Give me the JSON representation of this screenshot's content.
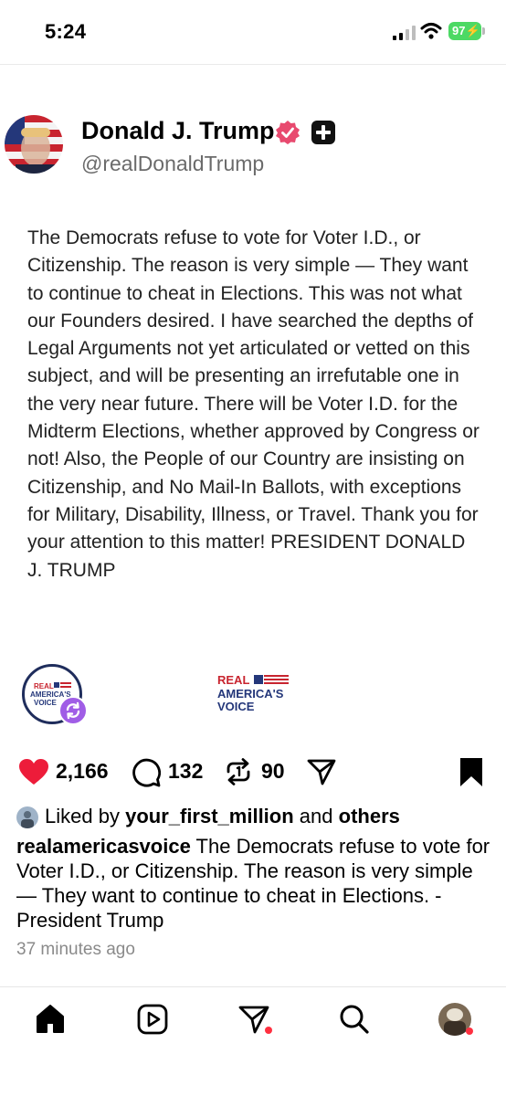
{
  "status_bar": {
    "time": "5:24",
    "battery": "97"
  },
  "post": {
    "author_name": "Donald J. Trump",
    "author_handle": "@realDonaldTrump",
    "body": "The Democrats refuse to vote for Voter I.D., or Citizenship. The reason is very simple — They want to continue to cheat in Elections. This was not what our Founders desired. I have searched the depths of Legal Arguments not yet articulated or vetted on this subject, and will be presenting an irrefutable one in the very near future. There will be Voter I.D. for the Midterm Elections, whether approved by Congress or not! Also, the People of our Country are insisting on Citizenship, and No Mail-In Ballots, with exceptions for Military, Disability, Illness, or Travel. Thank you for your attention to this matter! PRESIDENT DONALD J. TRUMP"
  },
  "logo": {
    "line1": "REAL",
    "line2": "AMERICA'S",
    "line3": "VOICE"
  },
  "actions": {
    "likes": "2,166",
    "comments": "132",
    "reposts": "90"
  },
  "liked_by": {
    "prefix": "Liked by",
    "user": "your_first_million",
    "joiner": "and",
    "suffix": "others"
  },
  "caption": {
    "user": "realamericasvoice",
    "text": "The Democrats refuse to vote for Voter I.D., or Citizenship. The reason is very simple — They want to continue to cheat in Elections. - President Trump"
  },
  "timestamp": "37 minutes ago",
  "icons": {
    "heart": "heart-icon",
    "comment": "comment-icon",
    "repost": "repost-icon",
    "share": "share-icon",
    "bookmark": "bookmark-icon",
    "home": "home-icon",
    "reels": "reels-icon",
    "send": "send-icon",
    "search": "search-icon"
  },
  "colors": {
    "like": "#ed1c3a",
    "verified": "#e84a6f",
    "repost_badge": "#a05de6",
    "notification": "#ff3040"
  }
}
